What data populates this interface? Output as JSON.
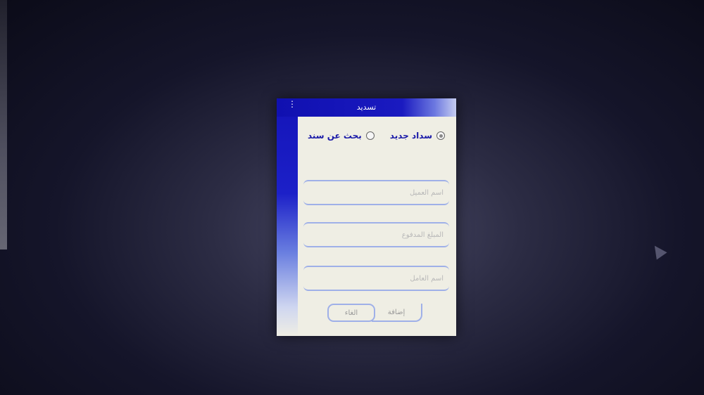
{
  "dialog": {
    "title": "تسديد",
    "menu_icon": "kebab-menu-icon"
  },
  "radios": [
    {
      "label": "سداد جديد",
      "checked": true
    },
    {
      "label": "بحث عن سند",
      "checked": false
    }
  ],
  "fields": {
    "customer_name": {
      "placeholder": "اسم العميل",
      "value": ""
    },
    "amount_paid": {
      "placeholder": "المبلغ المدفوع",
      "value": ""
    },
    "worker_name": {
      "placeholder": "اسم العامل",
      "value": ""
    }
  },
  "buttons": {
    "add_label": "إضافة",
    "cancel_label": "الغاء"
  },
  "colors": {
    "accent": "#1a1ac0",
    "field_border": "#9fb0e8",
    "dialog_bg": "#efeee4"
  }
}
